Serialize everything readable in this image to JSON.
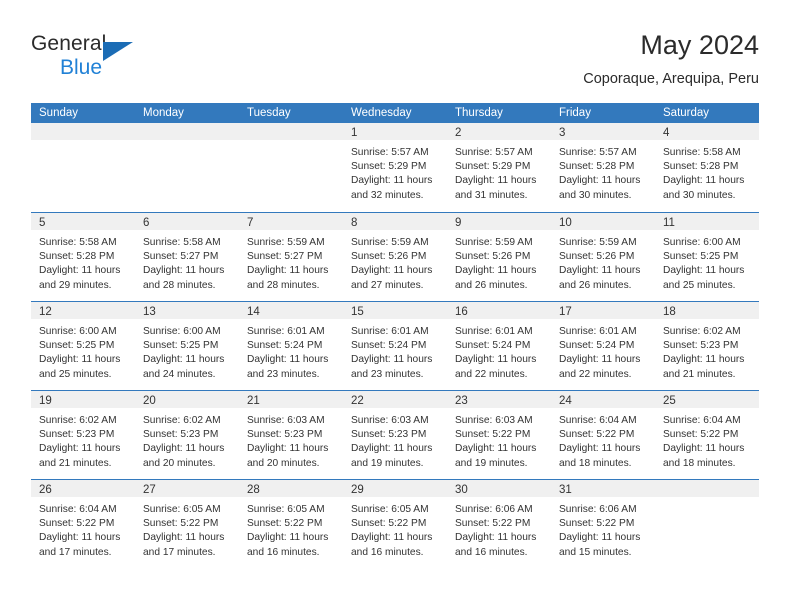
{
  "brand": {
    "name_top": "General",
    "name_bottom": "Blue",
    "triangle_color": "#1b6cb5",
    "blue_text_color": "#2181d6"
  },
  "header": {
    "title": "May 2024",
    "subtitle": "Coporaque, Arequipa, Peru"
  },
  "theme": {
    "header_blue": "#3379bd",
    "date_band_gray": "#f0f0f0",
    "text_color": "#333333"
  },
  "calendar": {
    "weekday_headers": [
      "Sunday",
      "Monday",
      "Tuesday",
      "Wednesday",
      "Thursday",
      "Friday",
      "Saturday"
    ],
    "weeks": [
      [
        {
          "date": "",
          "lines": []
        },
        {
          "date": "",
          "lines": []
        },
        {
          "date": "",
          "lines": []
        },
        {
          "date": "1",
          "lines": [
            "Sunrise: 5:57 AM",
            "Sunset: 5:29 PM",
            "Daylight: 11 hours",
            "and 32 minutes."
          ]
        },
        {
          "date": "2",
          "lines": [
            "Sunrise: 5:57 AM",
            "Sunset: 5:29 PM",
            "Daylight: 11 hours",
            "and 31 minutes."
          ]
        },
        {
          "date": "3",
          "lines": [
            "Sunrise: 5:57 AM",
            "Sunset: 5:28 PM",
            "Daylight: 11 hours",
            "and 30 minutes."
          ]
        },
        {
          "date": "4",
          "lines": [
            "Sunrise: 5:58 AM",
            "Sunset: 5:28 PM",
            "Daylight: 11 hours",
            "and 30 minutes."
          ]
        }
      ],
      [
        {
          "date": "5",
          "lines": [
            "Sunrise: 5:58 AM",
            "Sunset: 5:28 PM",
            "Daylight: 11 hours",
            "and 29 minutes."
          ]
        },
        {
          "date": "6",
          "lines": [
            "Sunrise: 5:58 AM",
            "Sunset: 5:27 PM",
            "Daylight: 11 hours",
            "and 28 minutes."
          ]
        },
        {
          "date": "7",
          "lines": [
            "Sunrise: 5:59 AM",
            "Sunset: 5:27 PM",
            "Daylight: 11 hours",
            "and 28 minutes."
          ]
        },
        {
          "date": "8",
          "lines": [
            "Sunrise: 5:59 AM",
            "Sunset: 5:26 PM",
            "Daylight: 11 hours",
            "and 27 minutes."
          ]
        },
        {
          "date": "9",
          "lines": [
            "Sunrise: 5:59 AM",
            "Sunset: 5:26 PM",
            "Daylight: 11 hours",
            "and 26 minutes."
          ]
        },
        {
          "date": "10",
          "lines": [
            "Sunrise: 5:59 AM",
            "Sunset: 5:26 PM",
            "Daylight: 11 hours",
            "and 26 minutes."
          ]
        },
        {
          "date": "11",
          "lines": [
            "Sunrise: 6:00 AM",
            "Sunset: 5:25 PM",
            "Daylight: 11 hours",
            "and 25 minutes."
          ]
        }
      ],
      [
        {
          "date": "12",
          "lines": [
            "Sunrise: 6:00 AM",
            "Sunset: 5:25 PM",
            "Daylight: 11 hours",
            "and 25 minutes."
          ]
        },
        {
          "date": "13",
          "lines": [
            "Sunrise: 6:00 AM",
            "Sunset: 5:25 PM",
            "Daylight: 11 hours",
            "and 24 minutes."
          ]
        },
        {
          "date": "14",
          "lines": [
            "Sunrise: 6:01 AM",
            "Sunset: 5:24 PM",
            "Daylight: 11 hours",
            "and 23 minutes."
          ]
        },
        {
          "date": "15",
          "lines": [
            "Sunrise: 6:01 AM",
            "Sunset: 5:24 PM",
            "Daylight: 11 hours",
            "and 23 minutes."
          ]
        },
        {
          "date": "16",
          "lines": [
            "Sunrise: 6:01 AM",
            "Sunset: 5:24 PM",
            "Daylight: 11 hours",
            "and 22 minutes."
          ]
        },
        {
          "date": "17",
          "lines": [
            "Sunrise: 6:01 AM",
            "Sunset: 5:24 PM",
            "Daylight: 11 hours",
            "and 22 minutes."
          ]
        },
        {
          "date": "18",
          "lines": [
            "Sunrise: 6:02 AM",
            "Sunset: 5:23 PM",
            "Daylight: 11 hours",
            "and 21 minutes."
          ]
        }
      ],
      [
        {
          "date": "19",
          "lines": [
            "Sunrise: 6:02 AM",
            "Sunset: 5:23 PM",
            "Daylight: 11 hours",
            "and 21 minutes."
          ]
        },
        {
          "date": "20",
          "lines": [
            "Sunrise: 6:02 AM",
            "Sunset: 5:23 PM",
            "Daylight: 11 hours",
            "and 20 minutes."
          ]
        },
        {
          "date": "21",
          "lines": [
            "Sunrise: 6:03 AM",
            "Sunset: 5:23 PM",
            "Daylight: 11 hours",
            "and 20 minutes."
          ]
        },
        {
          "date": "22",
          "lines": [
            "Sunrise: 6:03 AM",
            "Sunset: 5:23 PM",
            "Daylight: 11 hours",
            "and 19 minutes."
          ]
        },
        {
          "date": "23",
          "lines": [
            "Sunrise: 6:03 AM",
            "Sunset: 5:22 PM",
            "Daylight: 11 hours",
            "and 19 minutes."
          ]
        },
        {
          "date": "24",
          "lines": [
            "Sunrise: 6:04 AM",
            "Sunset: 5:22 PM",
            "Daylight: 11 hours",
            "and 18 minutes."
          ]
        },
        {
          "date": "25",
          "lines": [
            "Sunrise: 6:04 AM",
            "Sunset: 5:22 PM",
            "Daylight: 11 hours",
            "and 18 minutes."
          ]
        }
      ],
      [
        {
          "date": "26",
          "lines": [
            "Sunrise: 6:04 AM",
            "Sunset: 5:22 PM",
            "Daylight: 11 hours",
            "and 17 minutes."
          ]
        },
        {
          "date": "27",
          "lines": [
            "Sunrise: 6:05 AM",
            "Sunset: 5:22 PM",
            "Daylight: 11 hours",
            "and 17 minutes."
          ]
        },
        {
          "date": "28",
          "lines": [
            "Sunrise: 6:05 AM",
            "Sunset: 5:22 PM",
            "Daylight: 11 hours",
            "and 16 minutes."
          ]
        },
        {
          "date": "29",
          "lines": [
            "Sunrise: 6:05 AM",
            "Sunset: 5:22 PM",
            "Daylight: 11 hours",
            "and 16 minutes."
          ]
        },
        {
          "date": "30",
          "lines": [
            "Sunrise: 6:06 AM",
            "Sunset: 5:22 PM",
            "Daylight: 11 hours",
            "and 16 minutes."
          ]
        },
        {
          "date": "31",
          "lines": [
            "Sunrise: 6:06 AM",
            "Sunset: 5:22 PM",
            "Daylight: 11 hours",
            "and 15 minutes."
          ]
        },
        {
          "date": "",
          "lines": []
        }
      ]
    ]
  }
}
